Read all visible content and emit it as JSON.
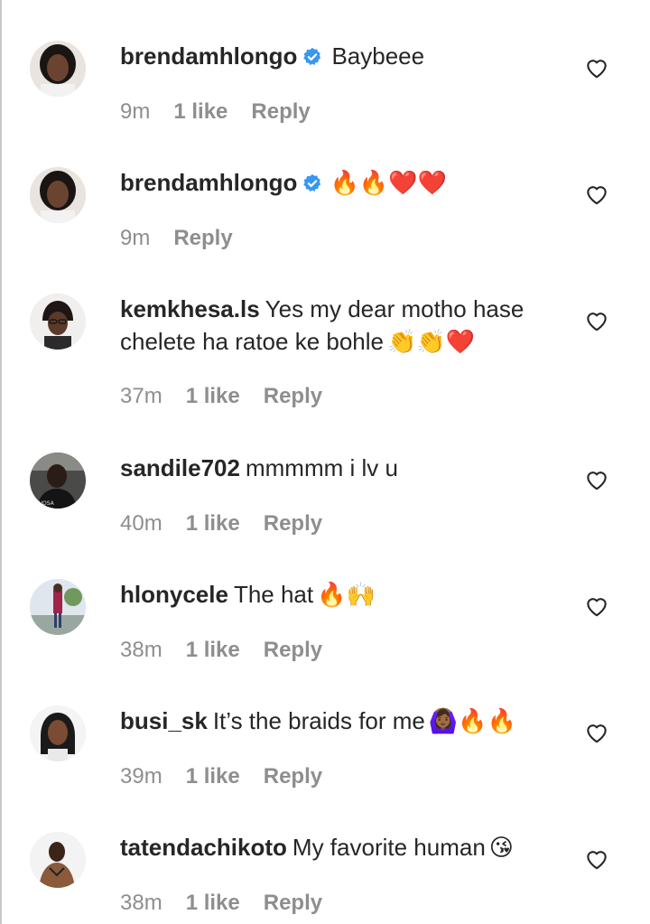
{
  "comments": [
    {
      "username": "brendamhlongo",
      "verified": true,
      "text": "Baybeee",
      "emojis": "",
      "time": "9m",
      "likes": "1 like",
      "reply": "Reply"
    },
    {
      "username": "brendamhlongo",
      "verified": true,
      "text": "",
      "emojis": "🔥🔥❤️❤️",
      "time": "9m",
      "likes": "",
      "reply": "Reply"
    },
    {
      "username": "kemkhesa.ls",
      "verified": false,
      "text": "Yes my dear motho hase chelete ha ratoe ke bohle",
      "emojis": "👏👏❤️",
      "time": "37m",
      "likes": "1 like",
      "reply": "Reply"
    },
    {
      "username": "sandile702",
      "verified": false,
      "text": "mmmmm i lv u",
      "emojis": "",
      "time": "40m",
      "likes": "1 like",
      "reply": "Reply"
    },
    {
      "username": "hlonycele",
      "verified": false,
      "text": "The hat",
      "emojis": "🔥🙌",
      "time": "38m",
      "likes": "1 like",
      "reply": "Reply"
    },
    {
      "username": "busi_sk",
      "verified": false,
      "text": "It’s the braids for me",
      "emojis": "🙆🏾‍♀️🔥🔥",
      "time": "39m",
      "likes": "1 like",
      "reply": "Reply"
    },
    {
      "username": "tatendachikoto",
      "verified": false,
      "text": "My favorite human",
      "emojis": "😘",
      "time": "38m",
      "likes": "1 like",
      "reply": "Reply"
    }
  ],
  "colors": {
    "text": "#262626",
    "meta": "#8e8e8e",
    "verified": "#3897f0",
    "background": "#ffffff"
  },
  "icons": {
    "verified": "verified-badge-icon",
    "like": "heart-outline-icon"
  }
}
